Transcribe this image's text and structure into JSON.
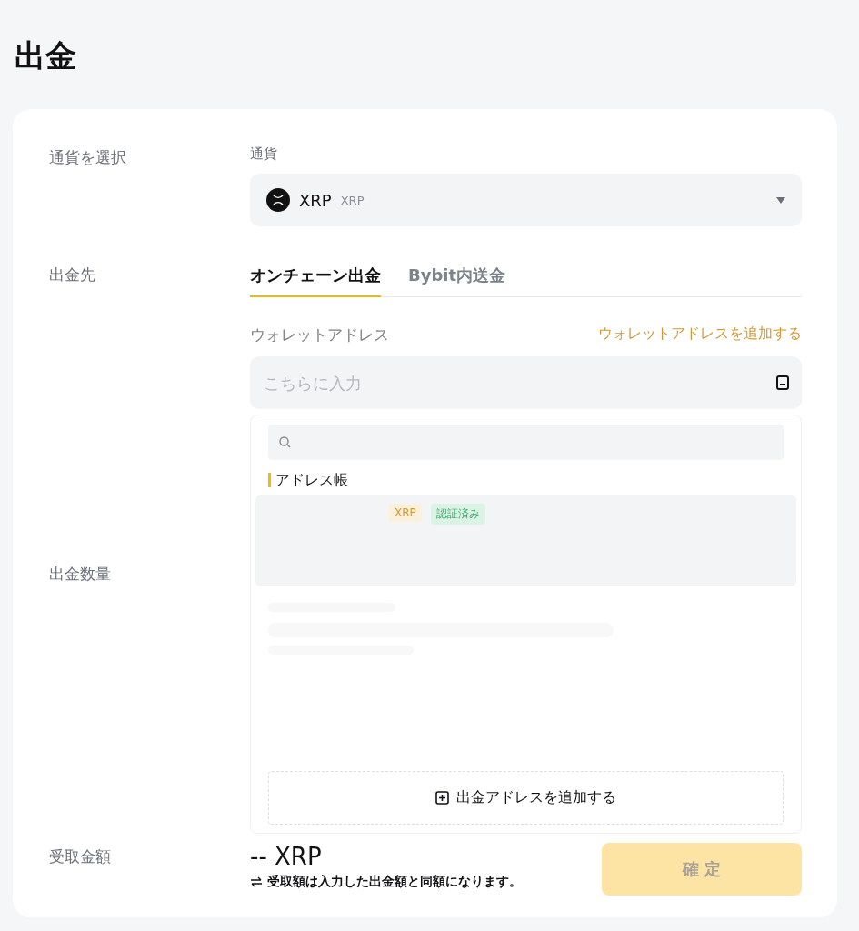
{
  "title": "出金",
  "currency_section": {
    "label": "通貨を選択",
    "field_label": "通貨",
    "selected": {
      "symbol": "XRP",
      "name": "XRP"
    }
  },
  "destination_section": {
    "label": "出金先",
    "tabs": [
      {
        "label": "オンチェーン出金",
        "selected": true
      },
      {
        "label": "Bybit内送金",
        "selected": false
      }
    ],
    "address_label": "ウォレットアドレス",
    "add_address_link": "ウォレットアドレスを追加する",
    "address_placeholder": "こちらに入力",
    "dropdown": {
      "section_title": "アドレス帳",
      "entries": [
        {
          "tags": [
            {
              "label": "XRP",
              "kind": "coin"
            },
            {
              "label": "認証済み",
              "kind": "verified"
            }
          ],
          "selected": true
        }
      ],
      "add_button": "出金アドレスを追加する"
    }
  },
  "amount_section": {
    "label": "出金数量"
  },
  "receive_section": {
    "label": "受取金額",
    "amount": "-- XRP",
    "note": "受取額は入力した出金額と同額になります。",
    "confirm_button": {
      "label": "確 定",
      "disabled": true
    }
  }
}
